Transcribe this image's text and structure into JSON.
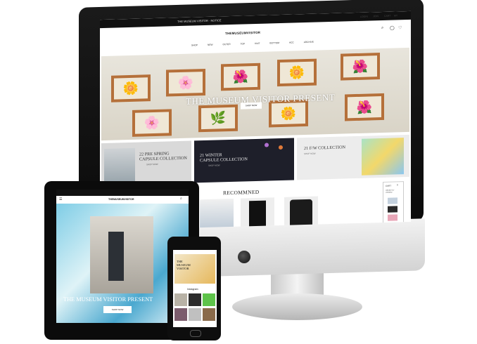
{
  "desktop": {
    "topbar_text": "THE MUSEUM VISITOR · NOTICE",
    "util_links": [
      "LOGIN",
      "JOIN",
      "CART",
      "MY"
    ],
    "logo": "THEMUSEUMVISITOR",
    "nav": [
      "SHOP",
      "NEW",
      "OUTER",
      "TOP",
      "KNIT",
      "BOTTOM",
      "ACC",
      "ARCHIVE"
    ],
    "hero": {
      "title": "THE MUSEUM VISITOR PRESENT",
      "button": "SHOP NOW"
    },
    "promos": [
      {
        "title": "22 PRE SPRING\nCAPSULE COLLECTION",
        "link": "SHOP NOW"
      },
      {
        "title": "21 WINTER\nCAPSULE COLLECTION",
        "link": "SHOP NOW"
      },
      {
        "title": "21 F/W COLLECTION",
        "link": "SHOP NOW"
      }
    ],
    "section_title": "RECOMMNED",
    "sidebar": {
      "label": "CART",
      "count": "0",
      "sub": "RECENTLY VIEWED"
    }
  },
  "tablet": {
    "logo": "THEMUSEUMVISITOR",
    "hero_title": "THE MUSEUM VISITOR PRESENT",
    "button": "SHOP NOW"
  },
  "phone": {
    "hero_title": "THE\nMUSEUM\nVISITOR",
    "section": "Instagram"
  },
  "colors": {
    "frame": "#b5703a",
    "bar": "#111111",
    "accent": "#7fcde6"
  }
}
